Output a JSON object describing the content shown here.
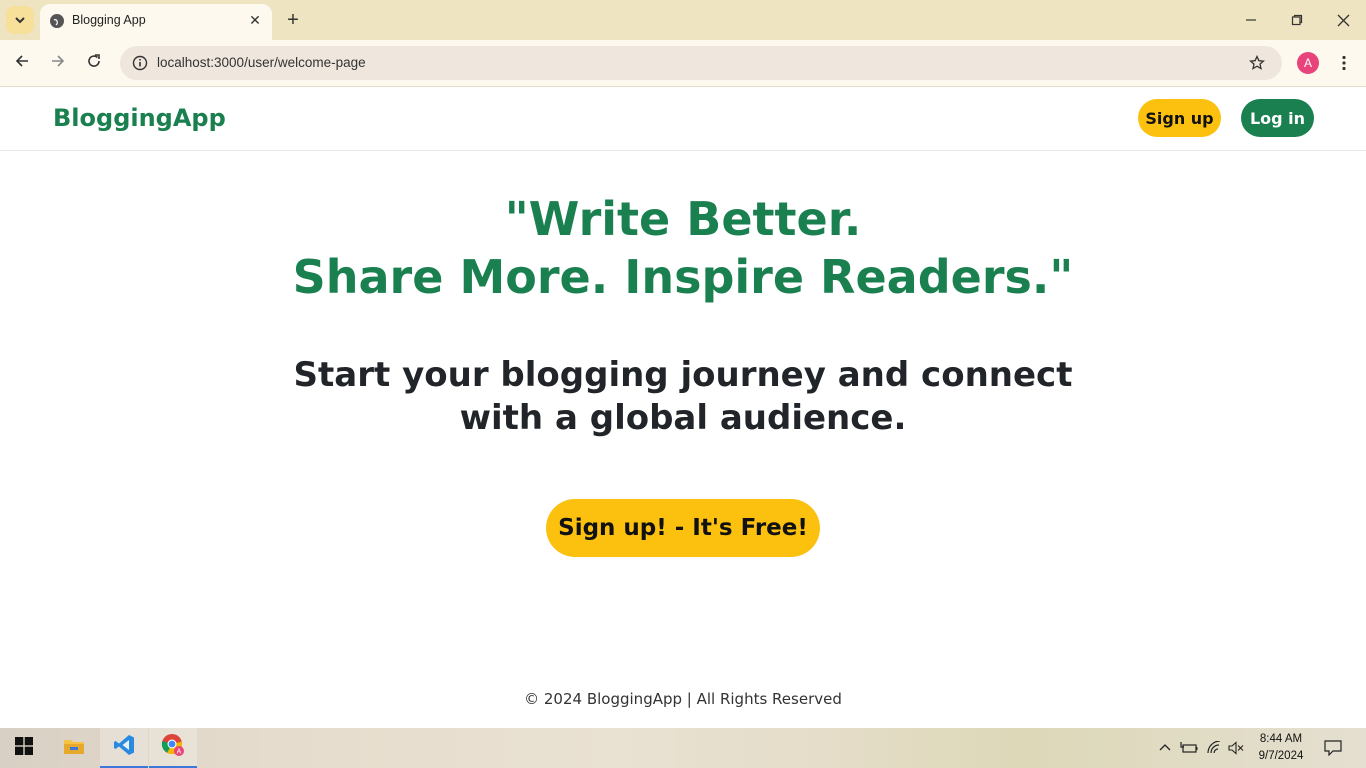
{
  "browser": {
    "tab_title": "Blogging App",
    "url": "localhost:3000/user/welcome-page",
    "profile_initial": "A",
    "accent_color": "#f7e09a"
  },
  "site": {
    "brand": "BloggingApp",
    "nav": {
      "signup_label": "Sign up",
      "login_label": "Log in"
    },
    "hero": {
      "line1": "\"Write Better.",
      "line2": "Share More. Inspire Readers.\""
    },
    "tagline": {
      "line1": "Start your blogging journey and connect",
      "line2": "with a global audience."
    },
    "cta_label": "Sign up! - It's Free!",
    "footer": "© 2024 BloggingApp | All Rights Reserved",
    "colors": {
      "primary_green": "#1b8050",
      "accent_yellow": "#fcc10e",
      "text_dark": "#212529"
    }
  },
  "taskbar": {
    "apps": [
      "windows-start",
      "file-explorer",
      "vs-code",
      "chrome"
    ],
    "time": "8:44 AM",
    "date": "9/7/2024"
  }
}
